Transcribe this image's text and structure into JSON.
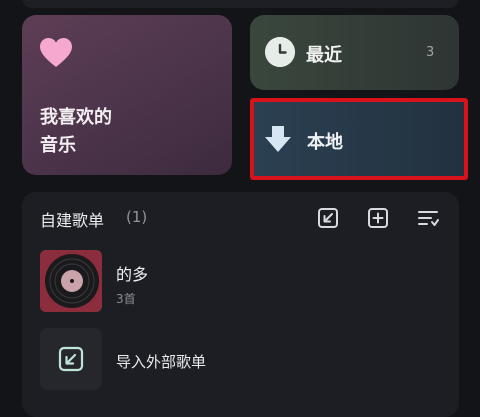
{
  "library": {
    "favorites": {
      "label": "我喜欢的\n音乐",
      "icon": "heart-icon",
      "color": "#f7a8cf"
    },
    "recent": {
      "label": "最近",
      "count": "3",
      "icon": "clock-icon"
    },
    "local": {
      "label": "本地",
      "icon": "download-arrow-icon",
      "highlight_color": "#d8121a"
    }
  },
  "playlists": {
    "title": "自建歌单",
    "count": "(1)",
    "toolbar": [
      "import-icon",
      "add-icon",
      "sort-icon"
    ],
    "items": [
      {
        "name": "的多",
        "meta": "3首"
      }
    ],
    "import_label": "导入外部歌单"
  }
}
